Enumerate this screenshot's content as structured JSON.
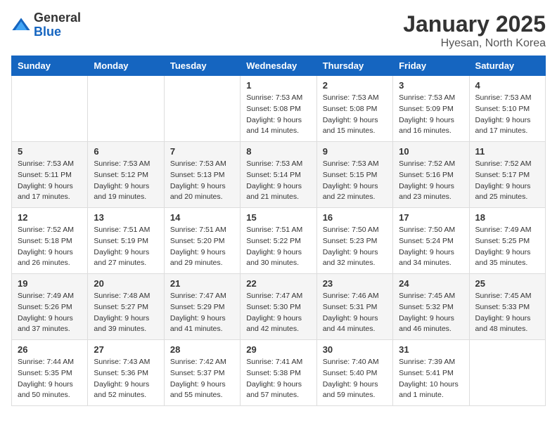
{
  "header": {
    "logo_general": "General",
    "logo_blue": "Blue",
    "title": "January 2025",
    "subtitle": "Hyesan, North Korea"
  },
  "days_of_week": [
    "Sunday",
    "Monday",
    "Tuesday",
    "Wednesday",
    "Thursday",
    "Friday",
    "Saturday"
  ],
  "weeks": [
    [
      {
        "day": "",
        "sunrise": "",
        "sunset": "",
        "daylight": ""
      },
      {
        "day": "",
        "sunrise": "",
        "sunset": "",
        "daylight": ""
      },
      {
        "day": "",
        "sunrise": "",
        "sunset": "",
        "daylight": ""
      },
      {
        "day": "1",
        "sunrise": "Sunrise: 7:53 AM",
        "sunset": "Sunset: 5:08 PM",
        "daylight": "Daylight: 9 hours and 14 minutes."
      },
      {
        "day": "2",
        "sunrise": "Sunrise: 7:53 AM",
        "sunset": "Sunset: 5:08 PM",
        "daylight": "Daylight: 9 hours and 15 minutes."
      },
      {
        "day": "3",
        "sunrise": "Sunrise: 7:53 AM",
        "sunset": "Sunset: 5:09 PM",
        "daylight": "Daylight: 9 hours and 16 minutes."
      },
      {
        "day": "4",
        "sunrise": "Sunrise: 7:53 AM",
        "sunset": "Sunset: 5:10 PM",
        "daylight": "Daylight: 9 hours and 17 minutes."
      }
    ],
    [
      {
        "day": "5",
        "sunrise": "Sunrise: 7:53 AM",
        "sunset": "Sunset: 5:11 PM",
        "daylight": "Daylight: 9 hours and 17 minutes."
      },
      {
        "day": "6",
        "sunrise": "Sunrise: 7:53 AM",
        "sunset": "Sunset: 5:12 PM",
        "daylight": "Daylight: 9 hours and 19 minutes."
      },
      {
        "day": "7",
        "sunrise": "Sunrise: 7:53 AM",
        "sunset": "Sunset: 5:13 PM",
        "daylight": "Daylight: 9 hours and 20 minutes."
      },
      {
        "day": "8",
        "sunrise": "Sunrise: 7:53 AM",
        "sunset": "Sunset: 5:14 PM",
        "daylight": "Daylight: 9 hours and 21 minutes."
      },
      {
        "day": "9",
        "sunrise": "Sunrise: 7:53 AM",
        "sunset": "Sunset: 5:15 PM",
        "daylight": "Daylight: 9 hours and 22 minutes."
      },
      {
        "day": "10",
        "sunrise": "Sunrise: 7:52 AM",
        "sunset": "Sunset: 5:16 PM",
        "daylight": "Daylight: 9 hours and 23 minutes."
      },
      {
        "day": "11",
        "sunrise": "Sunrise: 7:52 AM",
        "sunset": "Sunset: 5:17 PM",
        "daylight": "Daylight: 9 hours and 25 minutes."
      }
    ],
    [
      {
        "day": "12",
        "sunrise": "Sunrise: 7:52 AM",
        "sunset": "Sunset: 5:18 PM",
        "daylight": "Daylight: 9 hours and 26 minutes."
      },
      {
        "day": "13",
        "sunrise": "Sunrise: 7:51 AM",
        "sunset": "Sunset: 5:19 PM",
        "daylight": "Daylight: 9 hours and 27 minutes."
      },
      {
        "day": "14",
        "sunrise": "Sunrise: 7:51 AM",
        "sunset": "Sunset: 5:20 PM",
        "daylight": "Daylight: 9 hours and 29 minutes."
      },
      {
        "day": "15",
        "sunrise": "Sunrise: 7:51 AM",
        "sunset": "Sunset: 5:22 PM",
        "daylight": "Daylight: 9 hours and 30 minutes."
      },
      {
        "day": "16",
        "sunrise": "Sunrise: 7:50 AM",
        "sunset": "Sunset: 5:23 PM",
        "daylight": "Daylight: 9 hours and 32 minutes."
      },
      {
        "day": "17",
        "sunrise": "Sunrise: 7:50 AM",
        "sunset": "Sunset: 5:24 PM",
        "daylight": "Daylight: 9 hours and 34 minutes."
      },
      {
        "day": "18",
        "sunrise": "Sunrise: 7:49 AM",
        "sunset": "Sunset: 5:25 PM",
        "daylight": "Daylight: 9 hours and 35 minutes."
      }
    ],
    [
      {
        "day": "19",
        "sunrise": "Sunrise: 7:49 AM",
        "sunset": "Sunset: 5:26 PM",
        "daylight": "Daylight: 9 hours and 37 minutes."
      },
      {
        "day": "20",
        "sunrise": "Sunrise: 7:48 AM",
        "sunset": "Sunset: 5:27 PM",
        "daylight": "Daylight: 9 hours and 39 minutes."
      },
      {
        "day": "21",
        "sunrise": "Sunrise: 7:47 AM",
        "sunset": "Sunset: 5:29 PM",
        "daylight": "Daylight: 9 hours and 41 minutes."
      },
      {
        "day": "22",
        "sunrise": "Sunrise: 7:47 AM",
        "sunset": "Sunset: 5:30 PM",
        "daylight": "Daylight: 9 hours and 42 minutes."
      },
      {
        "day": "23",
        "sunrise": "Sunrise: 7:46 AM",
        "sunset": "Sunset: 5:31 PM",
        "daylight": "Daylight: 9 hours and 44 minutes."
      },
      {
        "day": "24",
        "sunrise": "Sunrise: 7:45 AM",
        "sunset": "Sunset: 5:32 PM",
        "daylight": "Daylight: 9 hours and 46 minutes."
      },
      {
        "day": "25",
        "sunrise": "Sunrise: 7:45 AM",
        "sunset": "Sunset: 5:33 PM",
        "daylight": "Daylight: 9 hours and 48 minutes."
      }
    ],
    [
      {
        "day": "26",
        "sunrise": "Sunrise: 7:44 AM",
        "sunset": "Sunset: 5:35 PM",
        "daylight": "Daylight: 9 hours and 50 minutes."
      },
      {
        "day": "27",
        "sunrise": "Sunrise: 7:43 AM",
        "sunset": "Sunset: 5:36 PM",
        "daylight": "Daylight: 9 hours and 52 minutes."
      },
      {
        "day": "28",
        "sunrise": "Sunrise: 7:42 AM",
        "sunset": "Sunset: 5:37 PM",
        "daylight": "Daylight: 9 hours and 55 minutes."
      },
      {
        "day": "29",
        "sunrise": "Sunrise: 7:41 AM",
        "sunset": "Sunset: 5:38 PM",
        "daylight": "Daylight: 9 hours and 57 minutes."
      },
      {
        "day": "30",
        "sunrise": "Sunrise: 7:40 AM",
        "sunset": "Sunset: 5:40 PM",
        "daylight": "Daylight: 9 hours and 59 minutes."
      },
      {
        "day": "31",
        "sunrise": "Sunrise: 7:39 AM",
        "sunset": "Sunset: 5:41 PM",
        "daylight": "Daylight: 10 hours and 1 minute."
      },
      {
        "day": "",
        "sunrise": "",
        "sunset": "",
        "daylight": ""
      }
    ]
  ]
}
